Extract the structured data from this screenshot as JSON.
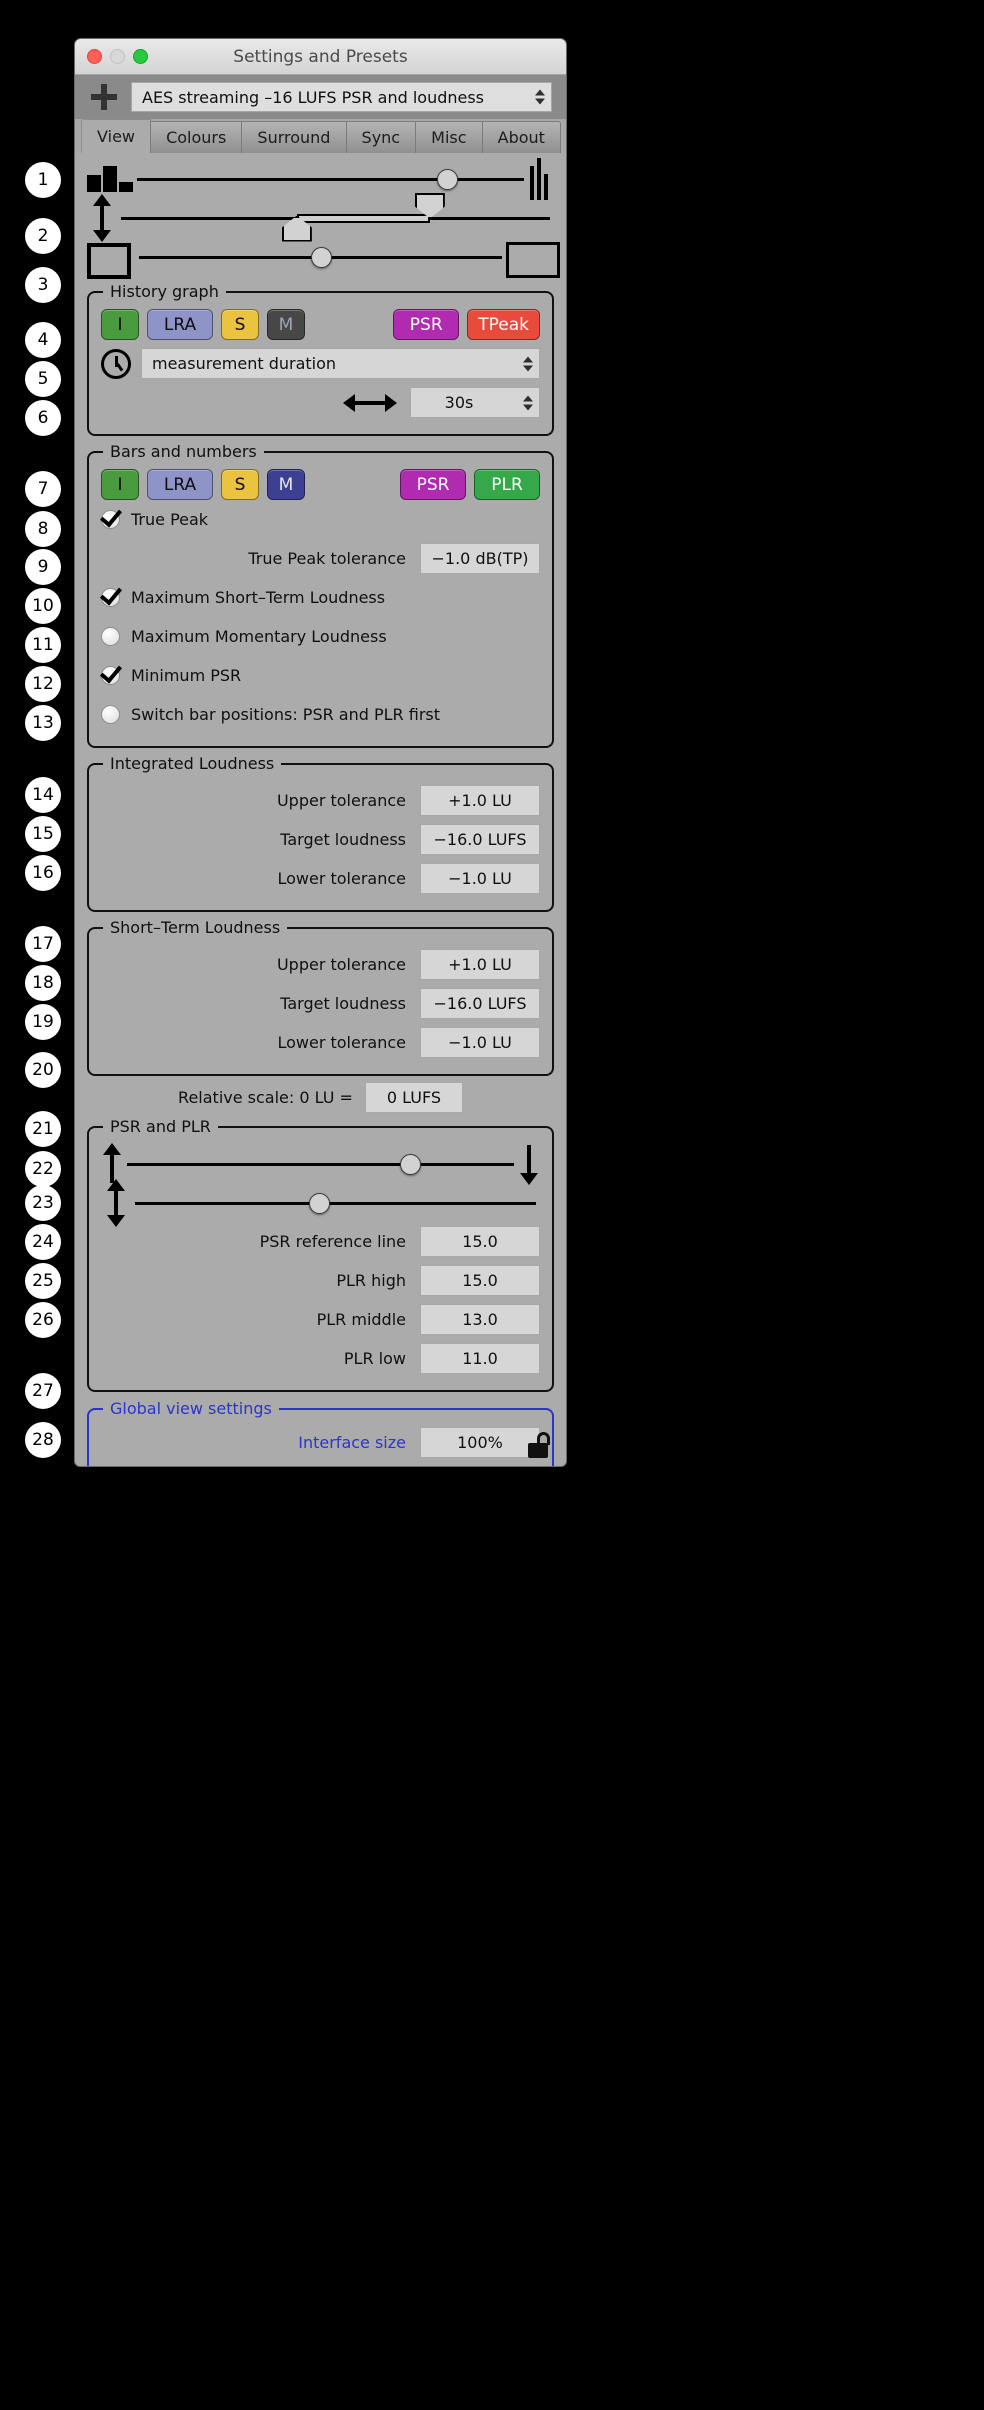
{
  "window": {
    "title": "Settings and Presets",
    "traffic_lights": [
      "close-red",
      "minimize-disabled",
      "zoom-green"
    ]
  },
  "preset": {
    "add_label": "+",
    "value": "AES streaming –16 LUFS PSR and loudness"
  },
  "tabs": [
    {
      "label": "View",
      "active": true
    },
    {
      "label": "Colours",
      "active": false
    },
    {
      "label": "Surround",
      "active": false
    },
    {
      "label": "Sync",
      "active": false
    },
    {
      "label": "Misc",
      "active": false
    },
    {
      "label": "About",
      "active": false
    }
  ],
  "sliders": {
    "bar_width": {
      "icon_left": "bar-width-icon",
      "icon_right": "thin-bars-icon",
      "value_pct": 80
    },
    "bar_height": {
      "icon_left": "vertical-resize-icon",
      "low_pct": 41,
      "high_pct": 72
    },
    "box_size": {
      "icon_left": "small-box-icon",
      "icon_right": "large-box-icon",
      "value_pct": 50
    }
  },
  "history_graph": {
    "legend": "History graph",
    "tags": [
      {
        "label": "I",
        "color": "#4a9a3f",
        "text": "#0d0d0d"
      },
      {
        "label": "LRA",
        "color": "#8e93c8",
        "text": "#0d0d0d"
      },
      {
        "label": "S",
        "color": "#eac340",
        "text": "#0d0d0d"
      },
      {
        "label": "M",
        "color": "#474747",
        "text": "#9aa6b5"
      },
      {
        "label": "PSR",
        "color": "#b02bb0",
        "text": "#ffffff"
      },
      {
        "label": "TPeak",
        "color": "#e84b3c",
        "text": "#ffffff"
      }
    ],
    "duration_mode": "measurement duration",
    "duration_icon": "clock-icon",
    "duration_value": "30s",
    "duration_arrow_icon": "horizontal-resize-icon"
  },
  "bars_and_numbers": {
    "legend": "Bars and numbers",
    "tags": [
      {
        "label": "I",
        "color": "#4a9a3f",
        "text": "#0d0d0d"
      },
      {
        "label": "LRA",
        "color": "#8e93c8",
        "text": "#0d0d0d"
      },
      {
        "label": "S",
        "color": "#eac340",
        "text": "#0d0d0d"
      },
      {
        "label": "M",
        "color": "#3c3f92",
        "text": "#e6e6e6"
      },
      {
        "label": "PSR",
        "color": "#b02bb0",
        "text": "#ffffff"
      },
      {
        "label": "PLR",
        "color": "#35a84a",
        "text": "#ffffff"
      }
    ],
    "options": [
      {
        "label": "True Peak",
        "checked": true
      },
      {
        "label": "Maximum Short–Term Loudness",
        "checked": true
      },
      {
        "label": "Maximum Momentary Loudness",
        "checked": false
      },
      {
        "label": "Minimum PSR",
        "checked": true
      },
      {
        "label": "Switch bar positions: PSR and PLR first",
        "checked": false
      }
    ],
    "true_peak_tolerance_label": "True Peak tolerance",
    "true_peak_tolerance_value": "−1.0 dB(TP)"
  },
  "integrated_loudness": {
    "legend": "Integrated Loudness",
    "fields": [
      {
        "label": "Upper tolerance",
        "value": "+1.0 LU"
      },
      {
        "label": "Target loudness",
        "value": "−16.0 LUFS"
      },
      {
        "label": "Lower tolerance",
        "value": "−1.0 LU"
      }
    ]
  },
  "short_term_loudness": {
    "legend": "Short–Term Loudness",
    "fields": [
      {
        "label": "Upper tolerance",
        "value": "+1.0 LU"
      },
      {
        "label": "Target loudness",
        "value": "−16.0 LUFS"
      },
      {
        "label": "Lower tolerance",
        "value": "−1.0 LU"
      }
    ]
  },
  "relative_scale": {
    "label": "Relative scale: 0 LU =",
    "value": "0 LUFS"
  },
  "psr_and_plr": {
    "legend": "PSR and PLR",
    "slider_top": {
      "icon_left": "arrow-up-icon",
      "icon_right": "arrow-down-icon",
      "value_pct": 73
    },
    "slider_bottom": {
      "icon_left": "vertical-resize-icon",
      "value_pct": 46
    },
    "fields": [
      {
        "label": "PSR reference line",
        "value": "15.0"
      },
      {
        "label": "PLR high",
        "value": "15.0"
      },
      {
        "label": "PLR middle",
        "value": "13.0"
      },
      {
        "label": "PLR low",
        "value": "11.0"
      }
    ]
  },
  "global_view_settings": {
    "legend": "Global view settings",
    "accent_color": "#2b35c8",
    "interface_size_label": "Interface size",
    "interface_size_value": "100%"
  },
  "footer": {
    "lock_icon": "lock-closed-icon"
  },
  "callouts": [
    "1",
    "2",
    "3",
    "4",
    "5",
    "6",
    "7",
    "8",
    "9",
    "10",
    "11",
    "12",
    "13",
    "14",
    "15",
    "16",
    "17",
    "18",
    "19",
    "20",
    "21",
    "22",
    "23",
    "24",
    "25",
    "26",
    "27",
    "28"
  ]
}
